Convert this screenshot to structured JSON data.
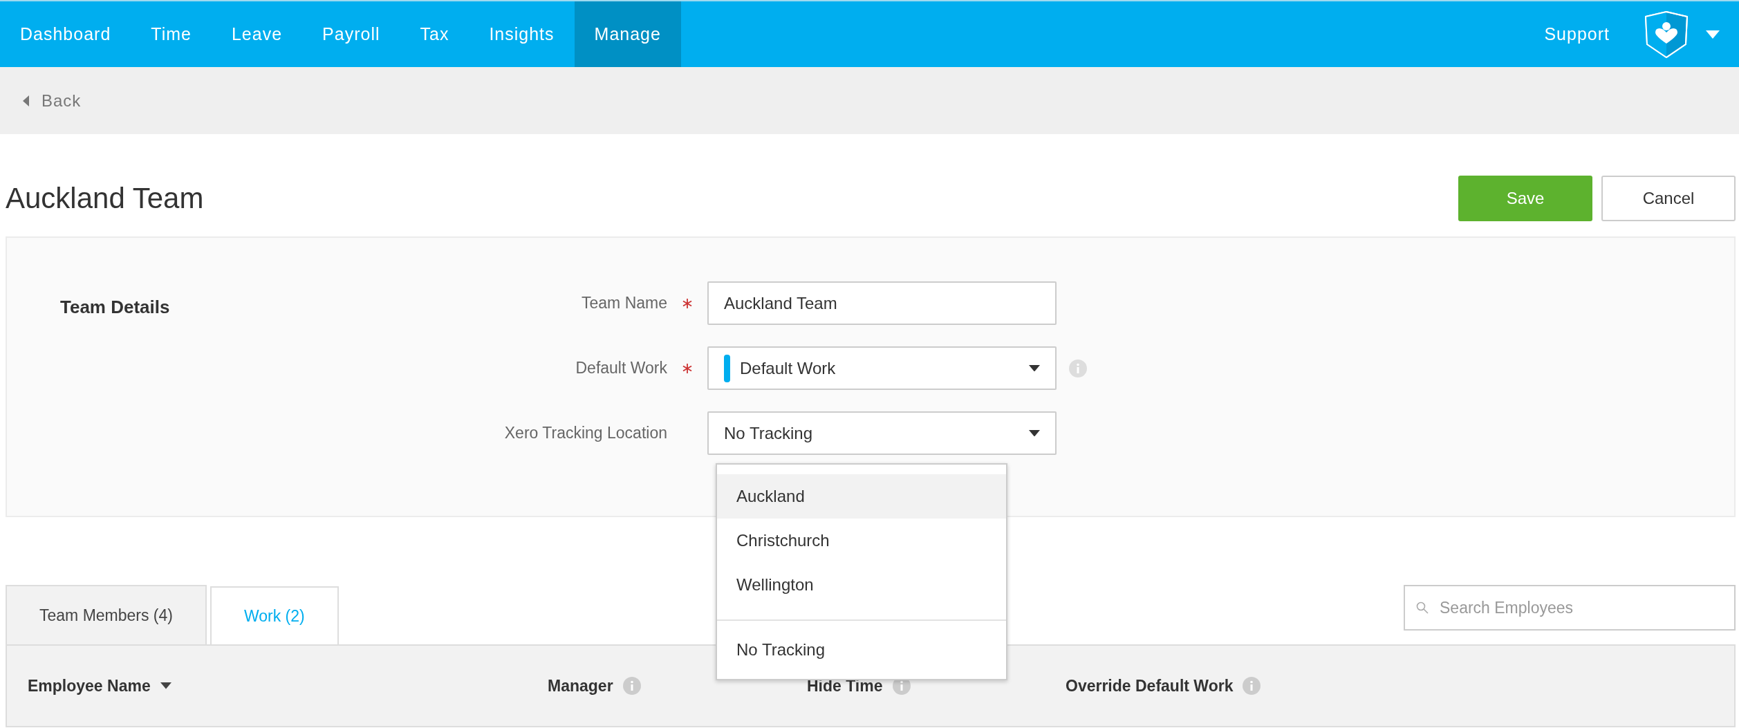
{
  "nav": {
    "items": [
      {
        "label": "Dashboard",
        "selected": false
      },
      {
        "label": "Time",
        "selected": false
      },
      {
        "label": "Leave",
        "selected": false
      },
      {
        "label": "Payroll",
        "selected": false
      },
      {
        "label": "Tax",
        "selected": false
      },
      {
        "label": "Insights",
        "selected": false
      },
      {
        "label": "Manage",
        "selected": true
      }
    ],
    "support": "Support"
  },
  "back": "Back",
  "page_title": "Auckland Team",
  "actions": {
    "save": "Save",
    "cancel": "Cancel"
  },
  "section": {
    "title": "Team Details",
    "fields": [
      {
        "kind": "text",
        "label": "Team Name",
        "required": true,
        "value": "Auckland Team",
        "info": false
      },
      {
        "kind": "select",
        "label": "Default Work",
        "required": true,
        "value": "Default Work",
        "color": "#00aeef",
        "info": true
      },
      {
        "kind": "select",
        "label": "Xero Tracking Location",
        "required": false,
        "value": "No Tracking",
        "info": false
      }
    ]
  },
  "dropdown": {
    "options": [
      {
        "label": "Auckland",
        "highlighted": true
      },
      {
        "label": "Christchurch",
        "highlighted": false
      },
      {
        "label": "Wellington",
        "highlighted": false
      }
    ],
    "clear_option": "No Tracking"
  },
  "tabs": [
    {
      "label": "Team Members (4)",
      "selected": true
    },
    {
      "label": "Work (2)",
      "selected": false
    }
  ],
  "search": {
    "placeholder": "Search Employees"
  },
  "table": {
    "columns": [
      {
        "label": "Employee Name",
        "sorted": true,
        "info": false
      },
      {
        "label": "Manager",
        "sorted": false,
        "info": true
      },
      {
        "label": "Hide Time",
        "sorted": false,
        "info": true
      },
      {
        "label": "Override Default Work",
        "sorted": false,
        "info": true
      }
    ]
  }
}
